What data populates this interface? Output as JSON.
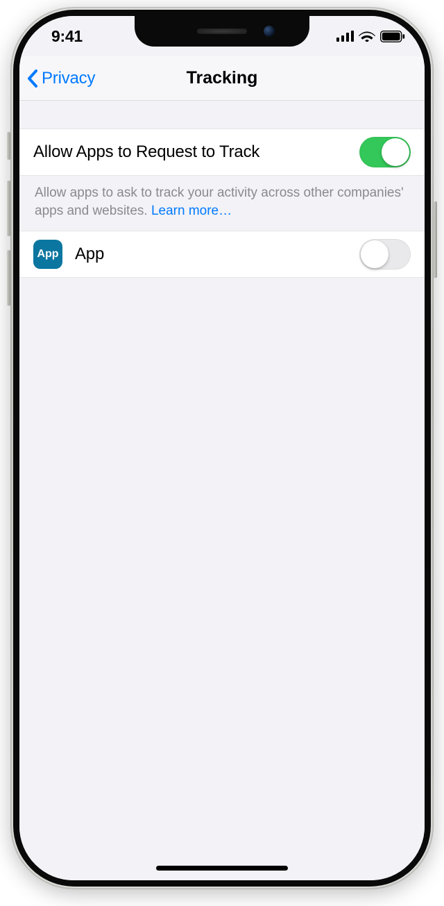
{
  "status_bar": {
    "time": "9:41"
  },
  "nav": {
    "back_label": "Privacy",
    "title": "Tracking"
  },
  "main_toggle": {
    "label": "Allow Apps to Request to Track",
    "on": true
  },
  "footer": {
    "text": "Allow apps to ask to track your activity across other companies' apps and websites. ",
    "link": "Learn more…"
  },
  "app_row": {
    "icon_text": "App",
    "label": "App",
    "on": false
  },
  "colors": {
    "accent": "#007aff",
    "toggle_on": "#34c759",
    "toggle_off": "#e9e9eb",
    "app_icon_bg": "#0b76a0",
    "settings_bg": "#f2f2f7"
  }
}
